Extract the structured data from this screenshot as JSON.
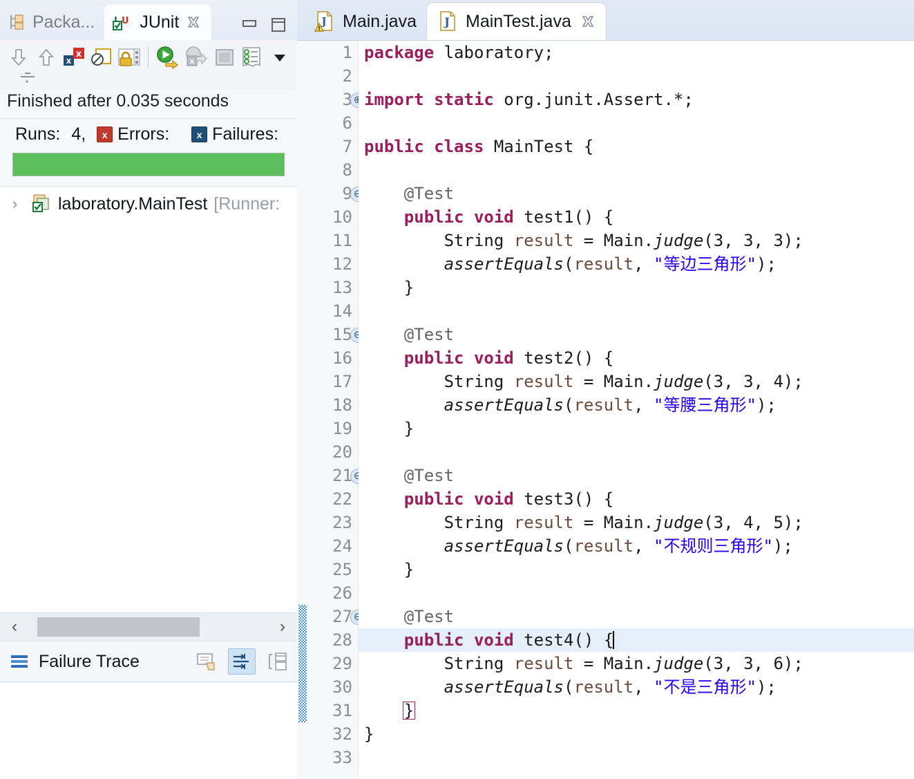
{
  "left_panel": {
    "tabs": [
      {
        "label": "Packa...",
        "icon": "package-explorer-icon",
        "active": false,
        "closable": false
      },
      {
        "label": "JUnit",
        "icon": "junit-icon",
        "active": true,
        "closable": true
      }
    ],
    "window_buttons": [
      {
        "name": "minimize-button",
        "label": "Minimize"
      },
      {
        "name": "maximize-button",
        "label": "Maximize"
      }
    ],
    "toolbar": [
      {
        "name": "next-failure-button",
        "icon": "arrow-down-icon",
        "tooltip": "Next Failed Test"
      },
      {
        "name": "previous-failure-button",
        "icon": "arrow-up-icon",
        "tooltip": "Previous Failed Test"
      },
      {
        "name": "show-failures-only-button",
        "icon": "show-failures-icon",
        "tooltip": "Show Failures Only"
      },
      {
        "name": "show-ignored-only-button",
        "icon": "show-ignored-icon",
        "tooltip": "Show Ignored Only"
      },
      {
        "name": "scroll-lock-button",
        "icon": "lock-icon",
        "tooltip": "Scroll Lock"
      },
      {
        "name": "rerun-test-button",
        "icon": "rerun-icon",
        "tooltip": "Rerun Test"
      },
      {
        "name": "rerun-failed-button",
        "icon": "rerun-failed-icon",
        "tooltip": "Rerun Test - Failures First"
      },
      {
        "name": "stop-button",
        "icon": "stop-icon",
        "tooltip": "Stop JUnit Test Run"
      },
      {
        "name": "test-history-button",
        "icon": "history-icon",
        "tooltip": "Test Run History"
      },
      {
        "name": "view-menu-button",
        "icon": "chevron-down-icon",
        "tooltip": "View Menu"
      }
    ],
    "status_text": "Finished after 0.035 seconds",
    "counters": {
      "runs_label": "Runs:",
      "runs_value": "4,",
      "errors_label": "Errors:",
      "errors_value": "",
      "failures_label": "Failures:",
      "failures_value": ""
    },
    "progress": {
      "percent": 100,
      "color": "#5cbe5c",
      "state": "passed"
    },
    "tree": [
      {
        "arrow": "›",
        "icon": "test-class-ok-icon",
        "label": "laboratory.MainTest",
        "suffix": "[Runner:"
      }
    ],
    "failure_trace": {
      "title": "Failure Trace",
      "icon": "failure-trace-icon",
      "buttons": [
        {
          "name": "compare-result-button",
          "icon": "compare-icon",
          "selected": false
        },
        {
          "name": "filter-stack-trace-button",
          "icon": "filter-stack-icon",
          "selected": true
        },
        {
          "name": "maximize-trace-button",
          "icon": "maximize-trace-icon",
          "selected": false
        }
      ]
    },
    "scrollbar": {
      "left_arrow": "‹",
      "right_arrow": "›"
    }
  },
  "editor": {
    "tabs": [
      {
        "label": "Main.java",
        "icon": "java-file-warning-icon",
        "active": false,
        "closable": false
      },
      {
        "label": "MainTest.java",
        "icon": "java-file-icon",
        "active": true,
        "closable": true
      }
    ],
    "cursor": {
      "line": 28,
      "column": 26
    },
    "current_line": 28,
    "changed_lines": [
      27,
      28,
      29,
      30,
      31
    ],
    "lines": [
      {
        "num": "1",
        "fold": "",
        "tokens": [
          {
            "t": "package",
            "c": "kw"
          },
          {
            "t": " laboratory;",
            "c": "type"
          }
        ]
      },
      {
        "num": "2",
        "fold": "",
        "tokens": []
      },
      {
        "num": "3",
        "fold": "+",
        "tokens": [
          {
            "t": "import static",
            "c": "kw"
          },
          {
            "t": " org.junit.Assert.*;",
            "c": "type"
          }
        ]
      },
      {
        "num": "6",
        "fold": "",
        "tokens": []
      },
      {
        "num": "7",
        "fold": "",
        "tokens": [
          {
            "t": "public class",
            "c": "kw"
          },
          {
            "t": " MainTest {",
            "c": "type"
          }
        ]
      },
      {
        "num": "8",
        "fold": "",
        "tokens": []
      },
      {
        "num": "9",
        "fold": "-",
        "tokens": [
          {
            "t": "    ",
            "c": "type"
          },
          {
            "t": "@Test",
            "c": "ann"
          }
        ]
      },
      {
        "num": "10",
        "fold": "",
        "tokens": [
          {
            "t": "    ",
            "c": "type"
          },
          {
            "t": "public void",
            "c": "kw"
          },
          {
            "t": " test1() {",
            "c": "type"
          }
        ]
      },
      {
        "num": "11",
        "fold": "",
        "tokens": [
          {
            "t": "        String ",
            "c": "type"
          },
          {
            "t": "result",
            "c": "lvar"
          },
          {
            "t": " = Main.",
            "c": "type"
          },
          {
            "t": "judge",
            "c": "stat"
          },
          {
            "t": "(3, 3, 3);",
            "c": "type"
          }
        ]
      },
      {
        "num": "12",
        "fold": "",
        "tokens": [
          {
            "t": "        ",
            "c": "type"
          },
          {
            "t": "assertEquals",
            "c": "stat"
          },
          {
            "t": "(",
            "c": "type"
          },
          {
            "t": "result",
            "c": "lvar"
          },
          {
            "t": ", ",
            "c": "type"
          },
          {
            "t": "\"等边三角形\"",
            "c": "str"
          },
          {
            "t": ");",
            "c": "type"
          }
        ]
      },
      {
        "num": "13",
        "fold": "",
        "tokens": [
          {
            "t": "    }",
            "c": "type"
          }
        ]
      },
      {
        "num": "14",
        "fold": "",
        "tokens": []
      },
      {
        "num": "15",
        "fold": "-",
        "tokens": [
          {
            "t": "    ",
            "c": "type"
          },
          {
            "t": "@Test",
            "c": "ann"
          }
        ]
      },
      {
        "num": "16",
        "fold": "",
        "tokens": [
          {
            "t": "    ",
            "c": "type"
          },
          {
            "t": "public void",
            "c": "kw"
          },
          {
            "t": " test2() {",
            "c": "type"
          }
        ]
      },
      {
        "num": "17",
        "fold": "",
        "tokens": [
          {
            "t": "        String ",
            "c": "type"
          },
          {
            "t": "result",
            "c": "lvar"
          },
          {
            "t": " = Main.",
            "c": "type"
          },
          {
            "t": "judge",
            "c": "stat"
          },
          {
            "t": "(3, 3, 4);",
            "c": "type"
          }
        ]
      },
      {
        "num": "18",
        "fold": "",
        "tokens": [
          {
            "t": "        ",
            "c": "type"
          },
          {
            "t": "assertEquals",
            "c": "stat"
          },
          {
            "t": "(",
            "c": "type"
          },
          {
            "t": "result",
            "c": "lvar"
          },
          {
            "t": ", ",
            "c": "type"
          },
          {
            "t": "\"等腰三角形\"",
            "c": "str"
          },
          {
            "t": ");",
            "c": "type"
          }
        ]
      },
      {
        "num": "19",
        "fold": "",
        "tokens": [
          {
            "t": "    }",
            "c": "type"
          }
        ]
      },
      {
        "num": "20",
        "fold": "",
        "tokens": []
      },
      {
        "num": "21",
        "fold": "-",
        "tokens": [
          {
            "t": "    ",
            "c": "type"
          },
          {
            "t": "@Test",
            "c": "ann"
          }
        ]
      },
      {
        "num": "22",
        "fold": "",
        "tokens": [
          {
            "t": "    ",
            "c": "type"
          },
          {
            "t": "public void",
            "c": "kw"
          },
          {
            "t": " test3() {",
            "c": "type"
          }
        ]
      },
      {
        "num": "23",
        "fold": "",
        "tokens": [
          {
            "t": "        String ",
            "c": "type"
          },
          {
            "t": "result",
            "c": "lvar"
          },
          {
            "t": " = Main.",
            "c": "type"
          },
          {
            "t": "judge",
            "c": "stat"
          },
          {
            "t": "(3, 4, 5);",
            "c": "type"
          }
        ]
      },
      {
        "num": "24",
        "fold": "",
        "tokens": [
          {
            "t": "        ",
            "c": "type"
          },
          {
            "t": "assertEquals",
            "c": "stat"
          },
          {
            "t": "(",
            "c": "type"
          },
          {
            "t": "result",
            "c": "lvar"
          },
          {
            "t": ", ",
            "c": "type"
          },
          {
            "t": "\"不规则三角形\"",
            "c": "str"
          },
          {
            "t": ");",
            "c": "type"
          }
        ]
      },
      {
        "num": "25",
        "fold": "",
        "tokens": [
          {
            "t": "    }",
            "c": "type"
          }
        ]
      },
      {
        "num": "26",
        "fold": "",
        "tokens": []
      },
      {
        "num": "27",
        "fold": "-",
        "tokens": [
          {
            "t": "    ",
            "c": "type"
          },
          {
            "t": "@Test",
            "c": "ann"
          }
        ]
      },
      {
        "num": "28",
        "fold": "",
        "tokens": [
          {
            "t": "    ",
            "c": "type"
          },
          {
            "t": "public void",
            "c": "kw"
          },
          {
            "t": " test4() {",
            "c": "type"
          }
        ],
        "caret": true
      },
      {
        "num": "29",
        "fold": "",
        "tokens": [
          {
            "t": "        String ",
            "c": "type"
          },
          {
            "t": "result",
            "c": "lvar"
          },
          {
            "t": " = Main.",
            "c": "type"
          },
          {
            "t": "judge",
            "c": "stat"
          },
          {
            "t": "(3, 3, 6);",
            "c": "type"
          }
        ]
      },
      {
        "num": "30",
        "fold": "",
        "tokens": [
          {
            "t": "        ",
            "c": "type"
          },
          {
            "t": "assertEquals",
            "c": "stat"
          },
          {
            "t": "(",
            "c": "type"
          },
          {
            "t": "result",
            "c": "lvar"
          },
          {
            "t": ", ",
            "c": "type"
          },
          {
            "t": "\"不是三角形\"",
            "c": "str"
          },
          {
            "t": ");",
            "c": "type"
          }
        ]
      },
      {
        "num": "31",
        "fold": "",
        "tokens": [
          {
            "t": "    ",
            "c": "type"
          },
          {
            "t": "}",
            "c": "matchbox"
          }
        ]
      },
      {
        "num": "32",
        "fold": "",
        "tokens": [
          {
            "t": "}",
            "c": "type"
          }
        ]
      },
      {
        "num": "33",
        "fold": "",
        "tokens": []
      }
    ]
  },
  "colors": {
    "keyword": "#9b1d5b",
    "string": "#2a00ff",
    "annotation": "#646464",
    "local_var": "#6a4b3c",
    "progress_green": "#5cbe5c",
    "current_line_bg": "#e5eff9",
    "change_bar": "#4a95d8"
  }
}
